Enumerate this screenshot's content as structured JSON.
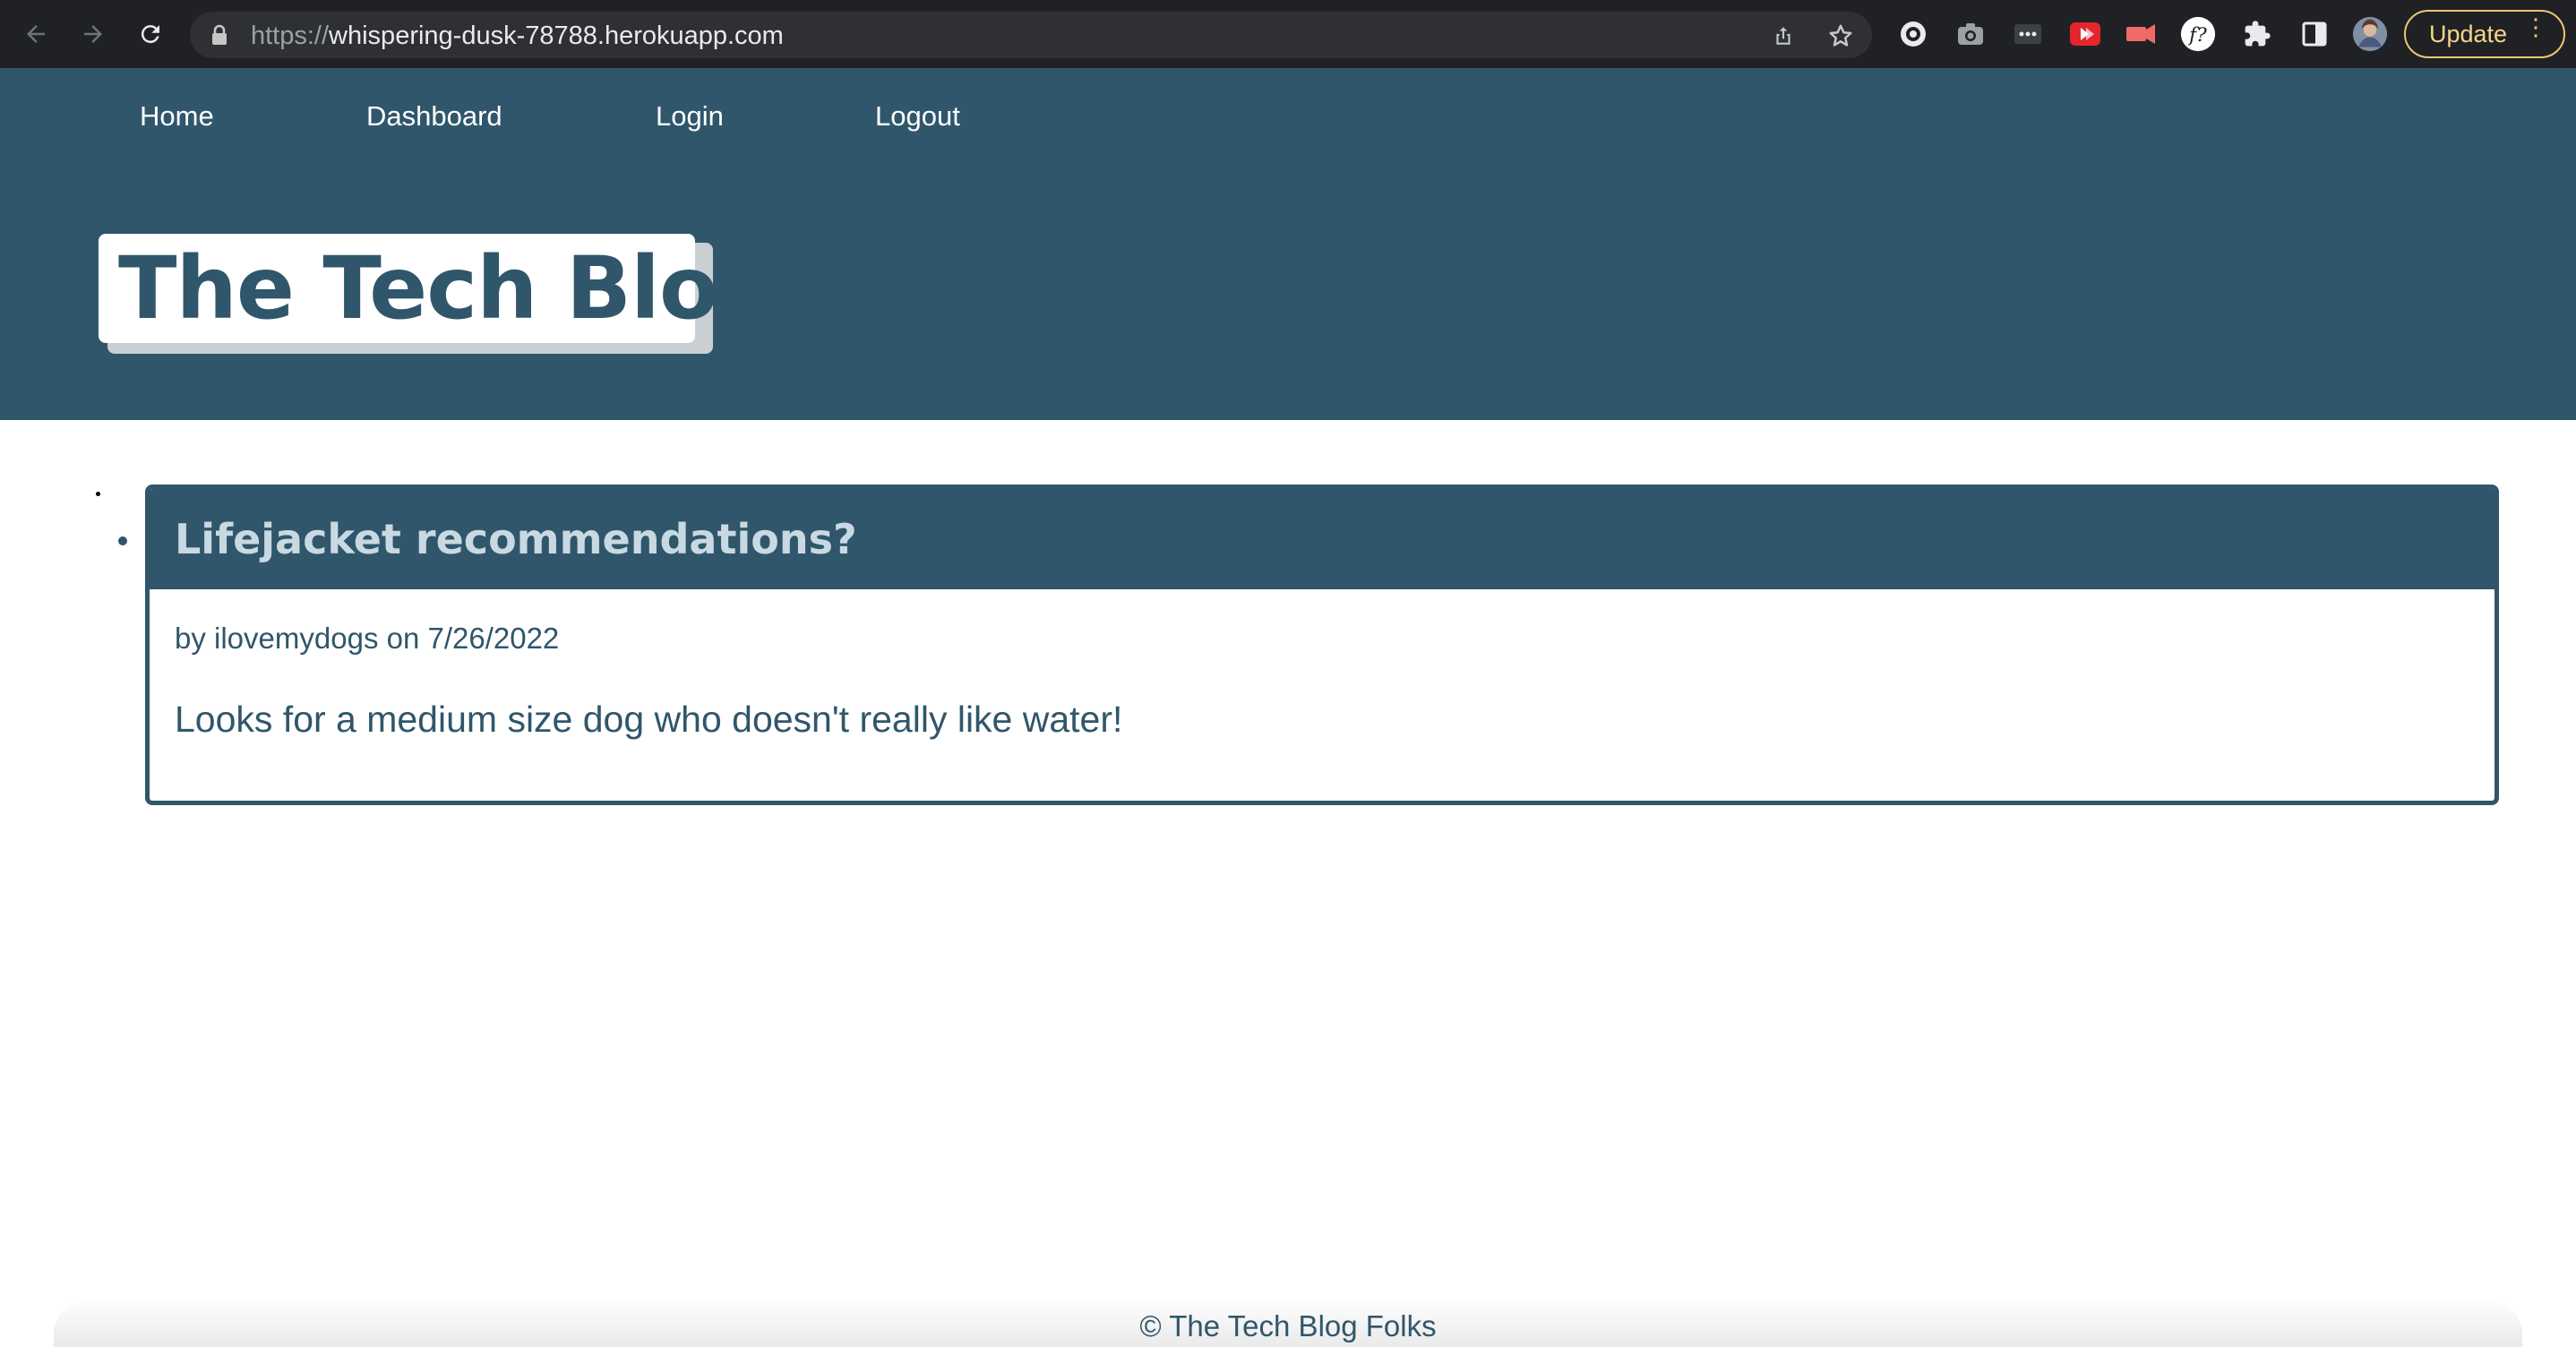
{
  "browser": {
    "url_scheme": "https://",
    "url_host": "whispering-dusk-78788.herokuapp.com",
    "update_label": "Update",
    "icons": [
      "back-arrow-icon",
      "forward-arrow-icon",
      "reload-icon",
      "lock-icon",
      "share-icon",
      "star-icon",
      "extension-icon",
      "camera-icon",
      "dots-extension-icon",
      "youtube-icon",
      "video-extension-icon",
      "font-extension-icon",
      "puzzle-icon",
      "sidebar-icon",
      "avatar"
    ]
  },
  "site": {
    "nav": [
      {
        "label": "Home"
      },
      {
        "label": "Dashboard"
      },
      {
        "label": "Login"
      },
      {
        "label": "Logout"
      }
    ],
    "title": "The Tech Blog"
  },
  "posts": [
    {
      "title": "Lifejacket recommendations?",
      "meta": "by ilovemydogs on 7/26/2022",
      "body": "Looks for a medium size dog who doesn't really like water!"
    }
  ],
  "footer": {
    "text": "© The Tech Blog Folks"
  },
  "colors": {
    "brand": "#30566b",
    "chrome": "#202124",
    "update_accent": "#f0c674"
  }
}
